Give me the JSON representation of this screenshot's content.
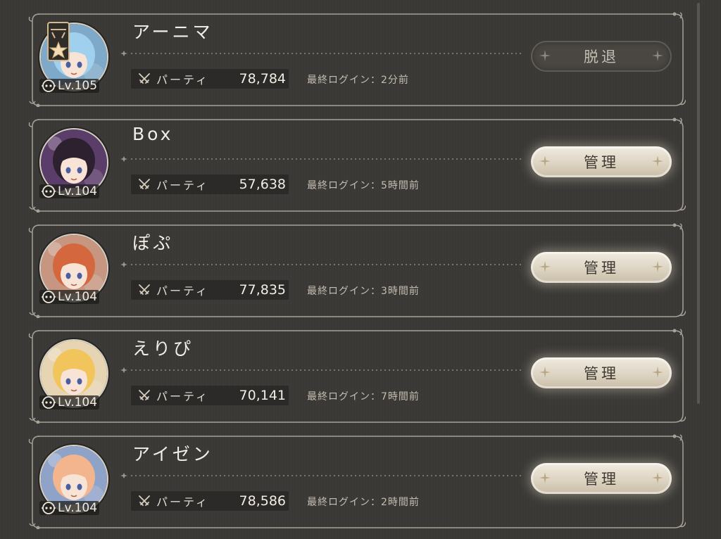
{
  "members": [
    {
      "name": "アーニマ",
      "level": "Lv.105",
      "party_label": "パーティ",
      "party_value": "78,784",
      "login": "最終ログイン：2分前",
      "action": "脱退",
      "action_type": "leave",
      "is_leader": true,
      "hair": "#9fd0ee",
      "bg": "#7fa9c8"
    },
    {
      "name": "Box",
      "level": "Lv.104",
      "party_label": "パーティ",
      "party_value": "57,638",
      "login": "最終ログイン：5時間前",
      "action": "管理",
      "action_type": "manage",
      "is_leader": false,
      "hair": "#2d2130",
      "bg": "#5b3d6a"
    },
    {
      "name": "ぽぷ",
      "level": "Lv.104",
      "party_label": "パーティ",
      "party_value": "77,835",
      "login": "最終ログイン：3時間前",
      "action": "管理",
      "action_type": "manage",
      "is_leader": false,
      "hair": "#d5673e",
      "bg": "#c79680"
    },
    {
      "name": "えりぴ",
      "level": "Lv.104",
      "party_label": "パーティ",
      "party_value": "70,141",
      "login": "最終ログイン：7時間前",
      "action": "管理",
      "action_type": "manage",
      "is_leader": false,
      "hair": "#f1c55c",
      "bg": "#e6d4b3"
    },
    {
      "name": "アイゼン",
      "level": "Lv.104",
      "party_label": "パーティ",
      "party_value": "78,586",
      "login": "最終ログイン：2時間前",
      "action": "管理",
      "action_type": "manage",
      "is_leader": false,
      "hair": "#f3b58e",
      "bg": "#8fa3c9"
    }
  ],
  "icons": {
    "leader_badge": "leader-badge-icon",
    "level": "level-icon",
    "party": "crossed-swords-icon",
    "spark": "sparkle-icon"
  }
}
